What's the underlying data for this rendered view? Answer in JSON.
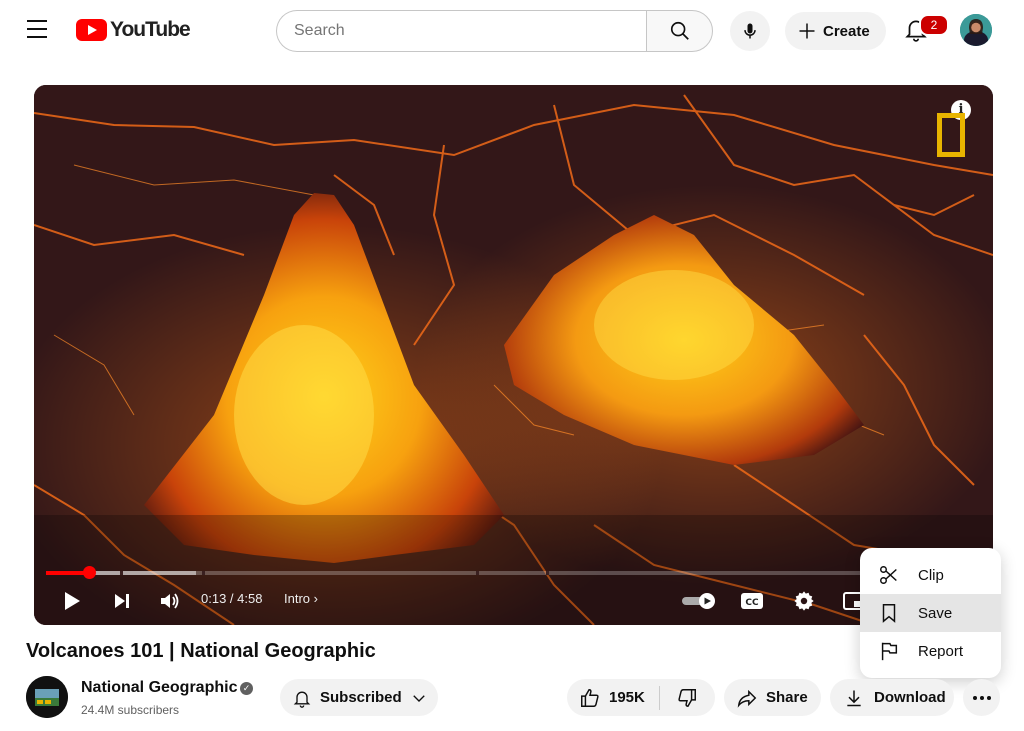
{
  "header": {
    "logo_text": "YouTube",
    "search_placeholder": "Search",
    "create_label": "Create",
    "notification_count": "2"
  },
  "player": {
    "time": "0:13 / 4:58",
    "chapter": "Intro",
    "progress_played": 0.046,
    "progress_loaded": 0.16
  },
  "menu": {
    "items": [
      {
        "label": "Clip",
        "icon": "scissors-icon"
      },
      {
        "label": "Save",
        "icon": "bookmark-icon"
      },
      {
        "label": "Report",
        "icon": "flag-icon"
      }
    ]
  },
  "video": {
    "title": "Volcanoes 101 | National Geographic",
    "channel_name": "National Geographic",
    "subscribers": "24.4M subscribers",
    "subscribed_label": "Subscribed",
    "likes": "195K",
    "share_label": "Share",
    "download_label": "Download"
  },
  "colors": {
    "brand_red": "#ff0000",
    "natgeo_yellow": "#e8b400",
    "pill_bg": "#f2f2f2"
  }
}
